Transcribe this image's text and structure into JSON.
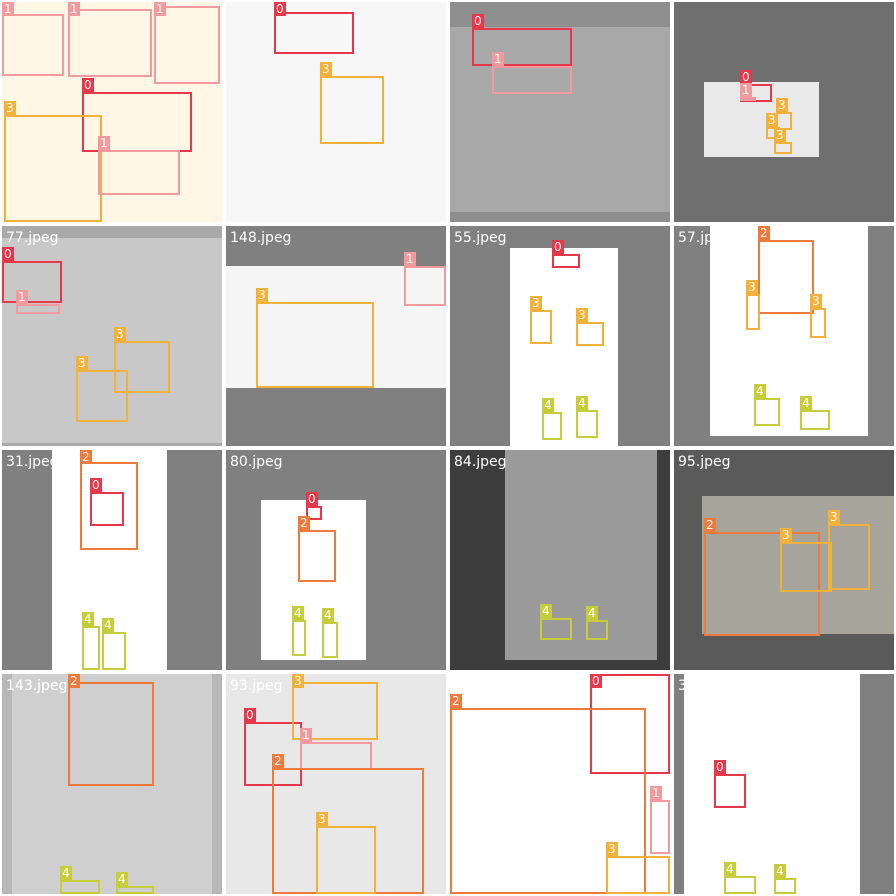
{
  "palette": {
    "0": "#e6384a",
    "1": "#f29a9e",
    "2": "#ee7a3c",
    "3": "#f2b13b",
    "4": "#c7cc3a"
  },
  "tiles": [
    {
      "filename": "",
      "background": "#fdf3e0",
      "boxes": [
        {
          "cls": "1"
        },
        {
          "cls": "1"
        },
        {
          "cls": "1"
        },
        {
          "cls": "0"
        },
        {
          "cls": "3"
        },
        {
          "cls": "1"
        }
      ]
    },
    {
      "filename": "",
      "background": "#f1f1f1",
      "boxes": [
        {
          "cls": "0"
        },
        {
          "cls": "3"
        }
      ]
    },
    {
      "filename": "",
      "background": "#8e8e8e",
      "boxes": [
        {
          "cls": "0"
        },
        {
          "cls": "1"
        }
      ]
    },
    {
      "filename": "",
      "background": "#6f6f6f",
      "boxes": [
        {
          "cls": "0"
        },
        {
          "cls": "1"
        },
        {
          "cls": "3"
        },
        {
          "cls": "3"
        },
        {
          "cls": "3"
        }
      ]
    },
    {
      "filename": "77.jpeg",
      "background": "#a9a9a9",
      "boxes": [
        {
          "cls": "0"
        },
        {
          "cls": "1"
        },
        {
          "cls": "3"
        },
        {
          "cls": "3"
        }
      ]
    },
    {
      "filename": "148.jpeg",
      "background": "#808080",
      "boxes": [
        {
          "cls": "1"
        },
        {
          "cls": "3"
        }
      ]
    },
    {
      "filename": "55.jpeg",
      "background": "#808080",
      "boxes": [
        {
          "cls": "0"
        },
        {
          "cls": "3"
        },
        {
          "cls": "3"
        },
        {
          "cls": "4"
        },
        {
          "cls": "4"
        }
      ]
    },
    {
      "filename": "57.jpeg",
      "background": "#808080",
      "boxes": [
        {
          "cls": "2"
        },
        {
          "cls": "3"
        },
        {
          "cls": "3"
        },
        {
          "cls": "4"
        },
        {
          "cls": "4"
        }
      ]
    },
    {
      "filename": "31.jpeg",
      "background": "#808080",
      "boxes": [
        {
          "cls": "2"
        },
        {
          "cls": "0"
        },
        {
          "cls": "4"
        },
        {
          "cls": "4"
        }
      ]
    },
    {
      "filename": "80.jpeg",
      "background": "#808080",
      "boxes": [
        {
          "cls": "0"
        },
        {
          "cls": "2"
        },
        {
          "cls": "4"
        },
        {
          "cls": "4"
        }
      ]
    },
    {
      "filename": "84.jpeg",
      "background": "#3d3d3d",
      "boxes": [
        {
          "cls": "4"
        },
        {
          "cls": "4"
        }
      ]
    },
    {
      "filename": "95.jpeg",
      "background": "#5a5a5a",
      "boxes": [
        {
          "cls": "2"
        },
        {
          "cls": "3"
        },
        {
          "cls": "3"
        }
      ]
    },
    {
      "filename": "143.jpeg",
      "background": "#b8b8b8",
      "boxes": [
        {
          "cls": "2"
        },
        {
          "cls": "4"
        },
        {
          "cls": "4"
        }
      ]
    },
    {
      "filename": "93.jpeg",
      "background": "#dcdcdc",
      "boxes": [
        {
          "cls": "0"
        },
        {
          "cls": "3"
        },
        {
          "cls": "1"
        },
        {
          "cls": "2"
        },
        {
          "cls": "3"
        }
      ]
    },
    {
      "filename": "113.jpeg",
      "background": "#f4f4f4",
      "boxes": [
        {
          "cls": "0"
        },
        {
          "cls": "2"
        },
        {
          "cls": "1"
        },
        {
          "cls": "3"
        }
      ]
    },
    {
      "filename": "39.jpeg",
      "background": "#808080",
      "boxes": [
        {
          "cls": "0"
        },
        {
          "cls": "4"
        },
        {
          "cls": "4"
        }
      ]
    }
  ]
}
